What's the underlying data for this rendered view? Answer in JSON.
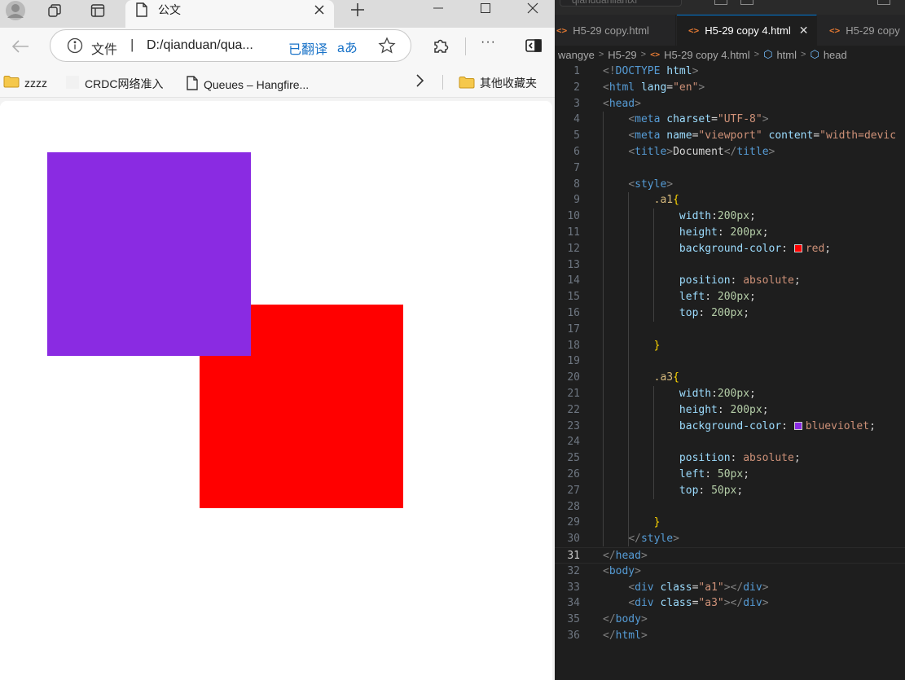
{
  "browser": {
    "tab_title": "公文",
    "address_scheme": "文件",
    "address_separator": "|",
    "address_url": "D:/qianduan/qua...",
    "translated_label": "已翻译",
    "translate_icon_text": "aあ",
    "more_label": "···",
    "bookmarks": [
      {
        "label": "zzzz",
        "icon": "folder-icon"
      },
      {
        "label": "CRDC网络准入",
        "icon": "blank-page-icon"
      },
      {
        "label": "Queues – Hangfire...",
        "icon": "page-icon"
      },
      {
        "label": "其他收藏夹",
        "icon": "folder-icon"
      }
    ]
  },
  "page": {
    "box_a1_color": "#ff0000",
    "box_a3_color": "#8a2be2"
  },
  "editor": {
    "search_text": "qianduanliantxi",
    "tabs": [
      {
        "label": "H5-29 copy.html",
        "active": false
      },
      {
        "label": "H5-29 copy 4.html",
        "active": true
      },
      {
        "label": "H5-29 copy",
        "active": false
      }
    ],
    "close_glyph": "✕",
    "breadcrumb": [
      "wangye",
      "H5-29",
      "H5-29 copy 4.html",
      "html",
      "head"
    ],
    "current_line": 31,
    "lines": [
      [
        [
          "tg",
          "<!"
        ],
        [
          "tn",
          "DOCTYPE"
        ],
        [
          "d",
          " "
        ],
        [
          "at",
          "html"
        ],
        [
          "tg",
          ">"
        ]
      ],
      [
        [
          "tg",
          "<"
        ],
        [
          "tn",
          "html"
        ],
        [
          "d",
          " "
        ],
        [
          "at",
          "lang"
        ],
        [
          "d",
          "="
        ],
        [
          "sv",
          "\"en\""
        ],
        [
          "tg",
          ">"
        ]
      ],
      [
        [
          "tg",
          "<"
        ],
        [
          "tn",
          "head"
        ],
        [
          "tg",
          ">"
        ]
      ],
      [
        [
          "d",
          "    "
        ],
        [
          "tg",
          "<"
        ],
        [
          "tn",
          "meta"
        ],
        [
          "d",
          " "
        ],
        [
          "at",
          "charset"
        ],
        [
          "d",
          "="
        ],
        [
          "sv",
          "\"UTF-8\""
        ],
        [
          "tg",
          ">"
        ]
      ],
      [
        [
          "d",
          "    "
        ],
        [
          "tg",
          "<"
        ],
        [
          "tn",
          "meta"
        ],
        [
          "d",
          " "
        ],
        [
          "at",
          "name"
        ],
        [
          "d",
          "="
        ],
        [
          "sv",
          "\"viewport\""
        ],
        [
          "d",
          " "
        ],
        [
          "at",
          "content"
        ],
        [
          "d",
          "="
        ],
        [
          "sv",
          "\"width=devic"
        ]
      ],
      [
        [
          "d",
          "    "
        ],
        [
          "tg",
          "<"
        ],
        [
          "tn",
          "title"
        ],
        [
          "tg",
          ">"
        ],
        [
          "d",
          "Document"
        ],
        [
          "tg",
          "</"
        ],
        [
          "tn",
          "title"
        ],
        [
          "tg",
          ">"
        ]
      ],
      [],
      [
        [
          "d",
          "    "
        ],
        [
          "tg",
          "<"
        ],
        [
          "tn",
          "style"
        ],
        [
          "tg",
          ">"
        ]
      ],
      [
        [
          "d",
          "        "
        ],
        [
          "sel",
          ".a1"
        ],
        [
          "br",
          "{"
        ]
      ],
      [
        [
          "d",
          "            "
        ],
        [
          "pr",
          "width"
        ],
        [
          "d",
          ":"
        ],
        [
          "num-v",
          "200px"
        ],
        [
          "d",
          ";"
        ]
      ],
      [
        [
          "d",
          "            "
        ],
        [
          "pr",
          "height"
        ],
        [
          "d",
          ": "
        ],
        [
          "num-v",
          "200px"
        ],
        [
          "d",
          ";"
        ]
      ],
      [
        [
          "d",
          "            "
        ],
        [
          "pr",
          "background-color"
        ],
        [
          "d",
          ": "
        ],
        [
          "sw",
          "#ff0000"
        ],
        [
          "kw",
          "red"
        ],
        [
          "d",
          ";"
        ]
      ],
      [],
      [
        [
          "d",
          "            "
        ],
        [
          "pr",
          "position"
        ],
        [
          "d",
          ": "
        ],
        [
          "kw",
          "absolute"
        ],
        [
          "d",
          ";"
        ]
      ],
      [
        [
          "d",
          "            "
        ],
        [
          "pr",
          "left"
        ],
        [
          "d",
          ": "
        ],
        [
          "num-v",
          "200px"
        ],
        [
          "d",
          ";"
        ]
      ],
      [
        [
          "d",
          "            "
        ],
        [
          "pr",
          "top"
        ],
        [
          "d",
          ": "
        ],
        [
          "num-v",
          "200px"
        ],
        [
          "d",
          ";"
        ]
      ],
      [],
      [
        [
          "d",
          "        "
        ],
        [
          "br",
          "}"
        ]
      ],
      [],
      [
        [
          "d",
          "        "
        ],
        [
          "sel",
          ".a3"
        ],
        [
          "br",
          "{"
        ]
      ],
      [
        [
          "d",
          "            "
        ],
        [
          "pr",
          "width"
        ],
        [
          "d",
          ":"
        ],
        [
          "num-v",
          "200px"
        ],
        [
          "d",
          ";"
        ]
      ],
      [
        [
          "d",
          "            "
        ],
        [
          "pr",
          "height"
        ],
        [
          "d",
          ": "
        ],
        [
          "num-v",
          "200px"
        ],
        [
          "d",
          ";"
        ]
      ],
      [
        [
          "d",
          "            "
        ],
        [
          "pr",
          "background-color"
        ],
        [
          "d",
          ": "
        ],
        [
          "sw",
          "#8a2be2"
        ],
        [
          "kw",
          "blueviolet"
        ],
        [
          "d",
          ";"
        ]
      ],
      [],
      [
        [
          "d",
          "            "
        ],
        [
          "pr",
          "position"
        ],
        [
          "d",
          ": "
        ],
        [
          "kw",
          "absolute"
        ],
        [
          "d",
          ";"
        ]
      ],
      [
        [
          "d",
          "            "
        ],
        [
          "pr",
          "left"
        ],
        [
          "d",
          ": "
        ],
        [
          "num-v",
          "50px"
        ],
        [
          "d",
          ";"
        ]
      ],
      [
        [
          "d",
          "            "
        ],
        [
          "pr",
          "top"
        ],
        [
          "d",
          ": "
        ],
        [
          "num-v",
          "50px"
        ],
        [
          "d",
          ";"
        ]
      ],
      [],
      [
        [
          "d",
          "        "
        ],
        [
          "br",
          "}"
        ]
      ],
      [
        [
          "d",
          "    "
        ],
        [
          "tg",
          "</"
        ],
        [
          "tn",
          "style"
        ],
        [
          "tg",
          ">"
        ]
      ],
      [
        [
          "tg",
          "</"
        ],
        [
          "tn",
          "head"
        ],
        [
          "tg",
          ">"
        ]
      ],
      [
        [
          "tg",
          "<"
        ],
        [
          "tn",
          "body"
        ],
        [
          "tg",
          ">"
        ]
      ],
      [
        [
          "d",
          "    "
        ],
        [
          "tg",
          "<"
        ],
        [
          "tn",
          "div"
        ],
        [
          "d",
          " "
        ],
        [
          "at",
          "class"
        ],
        [
          "d",
          "="
        ],
        [
          "sv",
          "\"a1\""
        ],
        [
          "tg",
          "></"
        ],
        [
          "tn",
          "div"
        ],
        [
          "tg",
          ">"
        ]
      ],
      [
        [
          "d",
          "    "
        ],
        [
          "tg",
          "<"
        ],
        [
          "tn",
          "div"
        ],
        [
          "d",
          " "
        ],
        [
          "at",
          "class"
        ],
        [
          "d",
          "="
        ],
        [
          "sv",
          "\"a3\""
        ],
        [
          "tg",
          "></"
        ],
        [
          "tn",
          "div"
        ],
        [
          "tg",
          ">"
        ]
      ],
      [
        [
          "tg",
          "</"
        ],
        [
          "tn",
          "body"
        ],
        [
          "tg",
          ">"
        ]
      ],
      [
        [
          "tg",
          "</"
        ],
        [
          "tn",
          "html"
        ],
        [
          "tg",
          ">"
        ]
      ]
    ]
  }
}
